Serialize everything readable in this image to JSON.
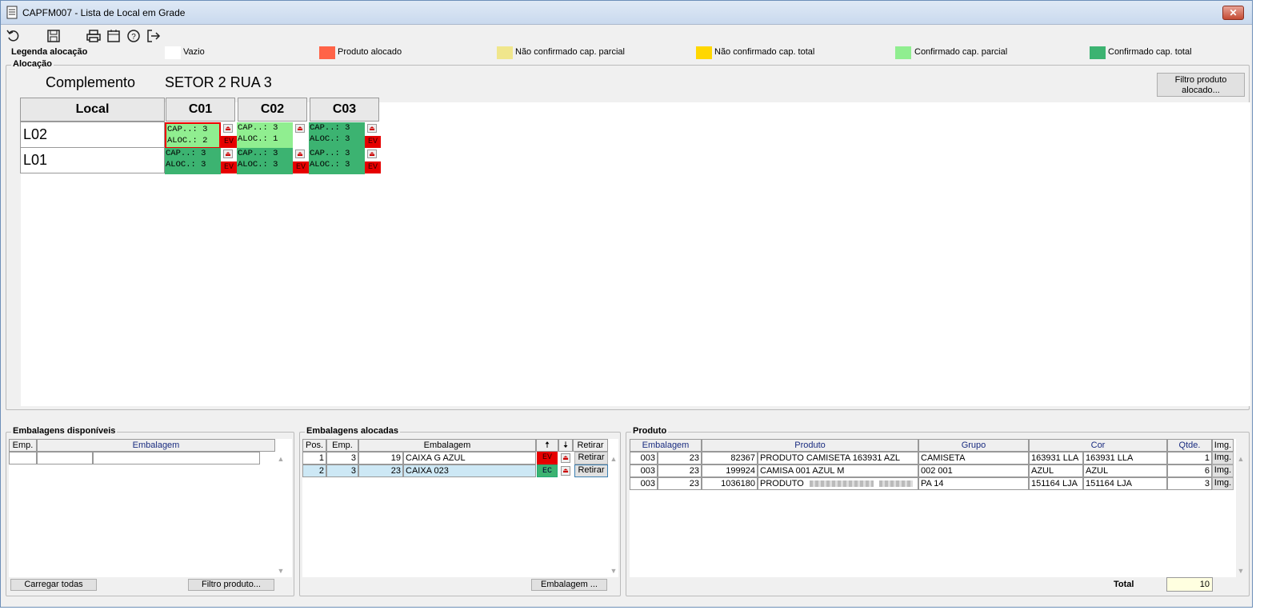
{
  "window": {
    "title": "CAPFM007 - Lista de Local em Grade",
    "close_label": "✕"
  },
  "toolbar": {
    "icons": [
      "undo-icon",
      "save-icon",
      "print-icon",
      "calendar-icon",
      "help-icon",
      "exit-icon"
    ]
  },
  "legend": {
    "title": "Legenda alocação",
    "items": [
      {
        "label": "Vazio",
        "color": "#ffffff"
      },
      {
        "label": "Produto alocado",
        "color": "#ff6347"
      },
      {
        "label": "Não confirmado cap. parcial",
        "color": "#f0e68c"
      },
      {
        "label": "Não confirmado cap. total",
        "color": "#ffd700"
      },
      {
        "label": "Confirmado cap. parcial",
        "color": "#90ee90"
      },
      {
        "label": "Confirmado cap. total",
        "color": "#3cb371"
      }
    ]
  },
  "alocacao": {
    "group_label": "Alocação",
    "complemento_label": "Complemento",
    "complemento_value": "SETOR 2 RUA 3",
    "filter_button": "Filtro produto alocado...",
    "local_header": "Local",
    "columns": [
      "C01",
      "C02",
      "C03"
    ],
    "rows": [
      {
        "label": "L02",
        "cells": [
          {
            "cap": "CAP..: 3",
            "aloc": "ALOC.: 2",
            "color": "#90ee90",
            "ev": "EV",
            "selected": true
          },
          {
            "cap": "CAP..: 3",
            "aloc": "ALOC.: 1",
            "color": "#90ee90",
            "ev": "",
            "selected": false
          },
          {
            "cap": "CAP..: 3",
            "aloc": "ALOC.: 3",
            "color": "#3cb371",
            "ev": "EV",
            "selected": false
          }
        ]
      },
      {
        "label": "L01",
        "cells": [
          {
            "cap": "CAP..: 3",
            "aloc": "ALOC.: 3",
            "color": "#3cb371",
            "ev": "EV",
            "selected": false
          },
          {
            "cap": "CAP..: 3",
            "aloc": "ALOC.: 3",
            "color": "#3cb371",
            "ev": "EV",
            "selected": false
          },
          {
            "cap": "CAP..: 3",
            "aloc": "ALOC.: 3",
            "color": "#3cb371",
            "ev": "EV",
            "selected": false
          }
        ]
      }
    ]
  },
  "disponiveis": {
    "group_label": "Embalagens disponíveis",
    "headers": [
      "Emp.",
      "Embalagem"
    ],
    "btn_load": "Carregar todas",
    "btn_filter": "Filtro produto..."
  },
  "alocadas": {
    "group_label": "Embalagens alocadas",
    "headers": [
      "Pos.",
      "Emp.",
      "Embalagem",
      "🠅",
      "🠇",
      "Retirar"
    ],
    "rows": [
      {
        "pos": "1",
        "emp": "3",
        "num": "19",
        "name": "CAIXA G AZUL",
        "status": "EV",
        "action": "Retirar"
      },
      {
        "pos": "2",
        "emp": "3",
        "num": "23",
        "name": "CAIXA 023",
        "status": "EC",
        "action": "Retirar"
      }
    ],
    "btn_embalagem": "Embalagem ..."
  },
  "produto": {
    "group_label": "Produto",
    "headers": [
      "Embalagem",
      "Produto",
      "Grupo",
      "Cor",
      "Qtde.",
      "Img."
    ],
    "rows": [
      {
        "emb1": "003",
        "emb2": "23",
        "code": "82367",
        "desc": "PRODUTO CAMISETA 163931 AZL",
        "grupo": "CAMISETA",
        "cor1": "163931 LLA",
        "cor2": "163931 LLA",
        "qtde": "1",
        "img": "Img."
      },
      {
        "emb1": "003",
        "emb2": "23",
        "code": "199924",
        "desc": "CAMISA 001 AZUL M",
        "grupo": "002 001",
        "cor1": "AZUL",
        "cor2": "AZUL",
        "qtde": "6",
        "img": "Img."
      },
      {
        "emb1": "003",
        "emb2": "23",
        "code": "1036180",
        "desc": "PRODUTO",
        "grupo": "PA 14",
        "cor1": "151164 LJA",
        "cor2": "151164 LJA",
        "qtde": "3",
        "img": "Img."
      }
    ],
    "total_label": "Total",
    "total_value": "10"
  }
}
